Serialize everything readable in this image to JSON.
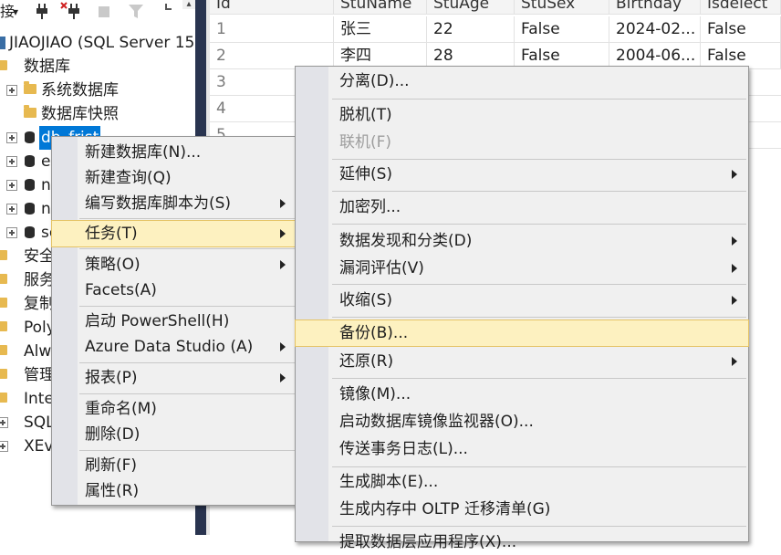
{
  "explorer": {
    "toolbar": {
      "connect": "接",
      "caret": "▾"
    },
    "server": "JIAOJIAO (SQL Server 15",
    "databases": "数据库",
    "system_databases": "系统数据库",
    "db_snapshots": "数据库快照",
    "selected_db": "db_frist",
    "db_rows": [
      "e",
      "n",
      "n",
      "se"
    ],
    "security": "安全",
    "server_objects": "服务",
    "replication": "复制",
    "polybase": "Poly",
    "always_on": "Alw",
    "management": "管理",
    "integration": "Inte",
    "sql_agent": "SQL",
    "xevent": "XEv"
  },
  "grid": {
    "columns": [
      "Id",
      "StuName",
      "StuAge",
      "StuSex",
      "Birthday",
      "Isdelect"
    ],
    "rows": [
      [
        "1",
        "张三",
        "22",
        "False",
        "2024-02...",
        "False"
      ],
      [
        "2",
        "李四",
        "28",
        "False",
        "2004-06...",
        "False"
      ],
      [
        "3",
        "",
        "",
        "",
        "",
        ""
      ],
      [
        "4",
        "",
        "",
        "",
        "",
        ""
      ],
      [
        "5",
        "",
        "",
        "",
        "",
        ""
      ]
    ]
  },
  "context_menu": {
    "items": [
      "新建数据库(N)...",
      "新建查询(Q)",
      "编写数据库脚本为(S)",
      "任务(T)",
      "策略(O)",
      "Facets(A)",
      "启动 PowerShell(H)",
      "Azure Data Studio (A)",
      "报表(P)",
      "重命名(M)",
      "删除(D)",
      "刷新(F)",
      "属性(R)"
    ]
  },
  "tasks_menu": {
    "items": [
      "分离(D)...",
      "脱机(T)",
      "联机(F)",
      "延伸(S)",
      "加密列...",
      "数据发现和分类(D)",
      "漏洞评估(V)",
      "收缩(S)",
      "备份(B)...",
      "还原(R)",
      "镜像(M)...",
      "启动数据库镜像监视器(O)...",
      "传送事务日志(L)...",
      "生成脚本(E)...",
      "生成内存中 OLTP 迁移清单(G)",
      "提取数据层应用程序(X)..."
    ]
  },
  "colors": {
    "highlight": "#fdf1c0",
    "selection": "#0078d7",
    "splitter": "#29344f"
  }
}
